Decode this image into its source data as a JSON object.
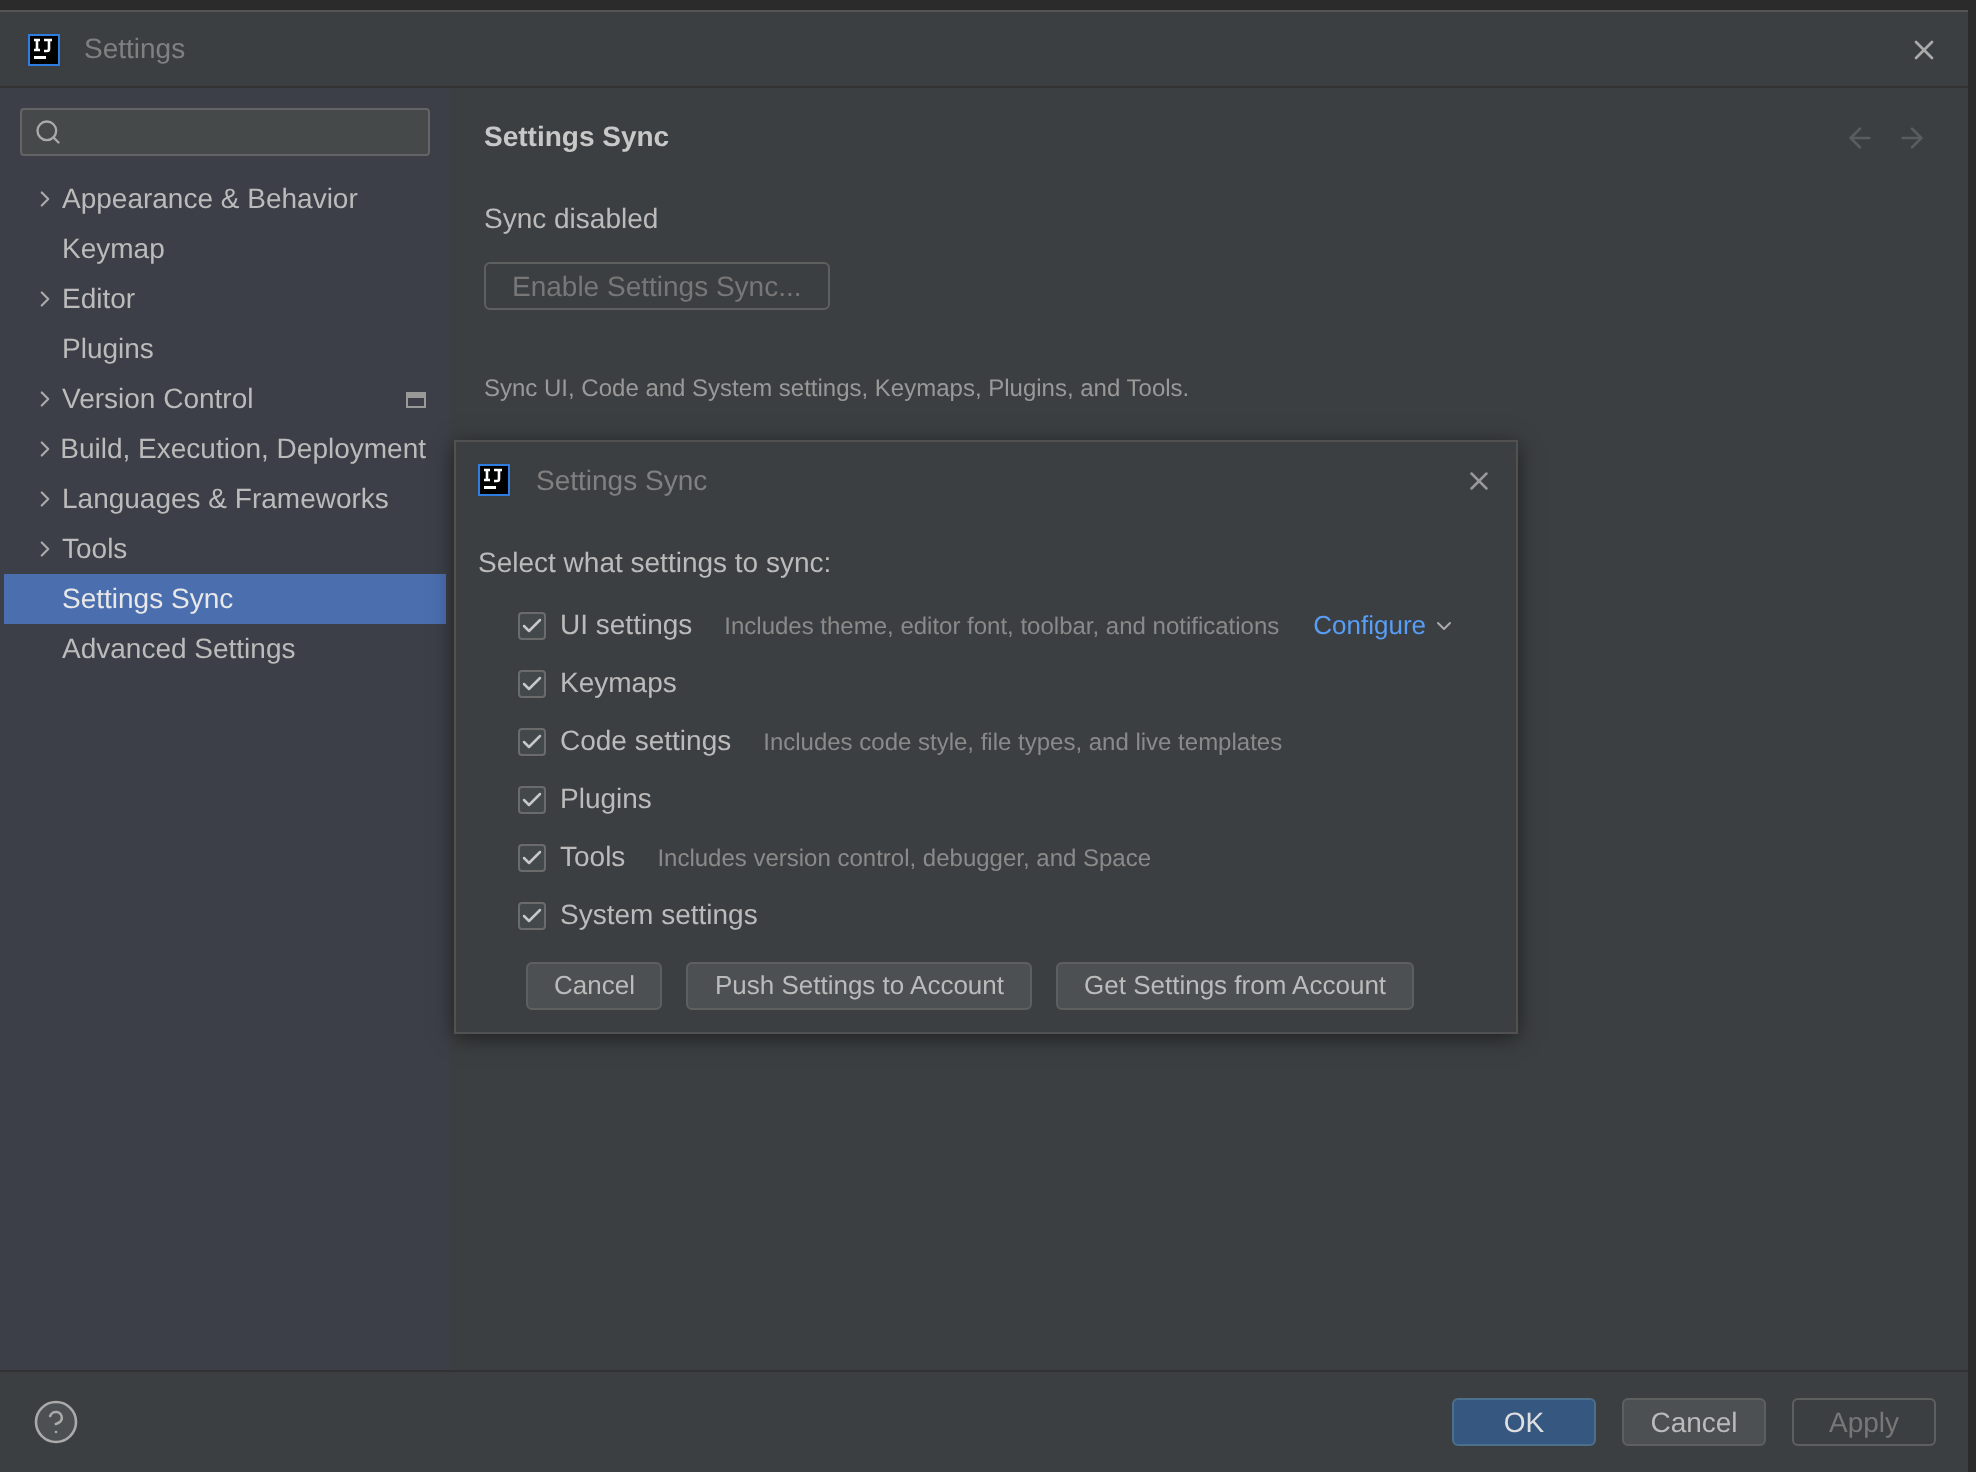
{
  "window": {
    "title": "Settings"
  },
  "sidebar": {
    "items": [
      {
        "label": "Appearance & Behavior",
        "expandable": true,
        "selected": false,
        "project_scoped": false
      },
      {
        "label": "Keymap",
        "expandable": false,
        "selected": false,
        "project_scoped": false
      },
      {
        "label": "Editor",
        "expandable": true,
        "selected": false,
        "project_scoped": false
      },
      {
        "label": "Plugins",
        "expandable": false,
        "selected": false,
        "project_scoped": false
      },
      {
        "label": "Version Control",
        "expandable": true,
        "selected": false,
        "project_scoped": true
      },
      {
        "label": "Build, Execution, Deployment",
        "expandable": true,
        "selected": false,
        "project_scoped": false
      },
      {
        "label": "Languages & Frameworks",
        "expandable": true,
        "selected": false,
        "project_scoped": false
      },
      {
        "label": "Tools",
        "expandable": true,
        "selected": false,
        "project_scoped": false
      },
      {
        "label": "Settings Sync",
        "expandable": false,
        "selected": true,
        "project_scoped": false
      },
      {
        "label": "Advanced Settings",
        "expandable": false,
        "selected": false,
        "project_scoped": false
      }
    ]
  },
  "content": {
    "heading": "Settings Sync",
    "status": "Sync disabled",
    "enable_button": {
      "label": "Enable Settings Sync...",
      "disabled": true
    },
    "description": "Sync UI, Code and System settings, Keymaps, Plugins, and Tools."
  },
  "dialog": {
    "title": "Settings Sync",
    "prompt": "Select what settings to sync:",
    "options": [
      {
        "label": "UI settings",
        "checked": true,
        "hint": "Includes theme, editor font, toolbar, and notifications",
        "link": "Configure"
      },
      {
        "label": "Keymaps",
        "checked": true
      },
      {
        "label": "Code settings",
        "checked": true,
        "hint": "Includes code style, file types, and live templates"
      },
      {
        "label": "Plugins",
        "checked": true
      },
      {
        "label": "Tools",
        "checked": true,
        "hint": "Includes version control, debugger, and Space"
      },
      {
        "label": "System settings",
        "checked": true
      }
    ],
    "buttons": [
      "Cancel",
      "Push Settings to Account",
      "Get Settings from Account"
    ]
  },
  "footer": {
    "buttons": [
      {
        "label": "OK",
        "kind": "default",
        "disabled": false
      },
      {
        "label": "Cancel",
        "kind": "normal",
        "disabled": false
      },
      {
        "label": "Apply",
        "kind": "normal",
        "disabled": true
      }
    ]
  }
}
